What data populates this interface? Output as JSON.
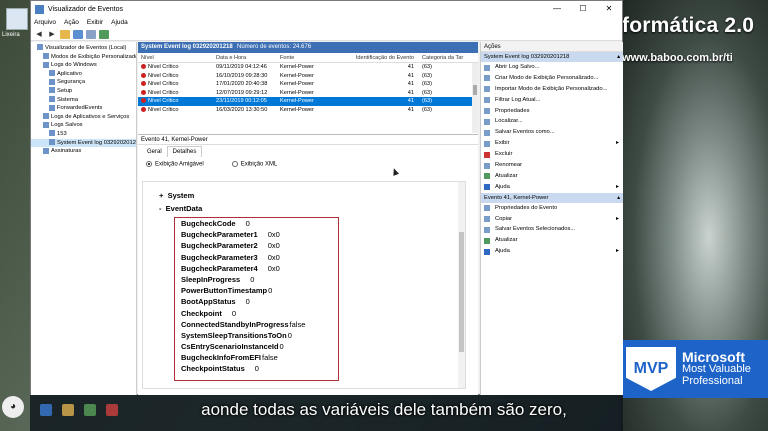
{
  "window": {
    "title": "Visualizador de Eventos",
    "controls": {
      "minimize": "—",
      "maximize": "☐",
      "close": "✕"
    }
  },
  "desktop": {
    "icon_label": "Lixeira",
    "brand": "formática 2.0",
    "brand_url": "www.baboo.com.br/ti",
    "mvp": {
      "logo": "MVP",
      "line1": "Microsoft",
      "line2": "Most Valuable",
      "line3": "Professional"
    }
  },
  "menu": [
    "Arquivo",
    "Ação",
    "Exibir",
    "Ajuda"
  ],
  "tree": [
    {
      "label": "Visualizador de Eventos (Local)",
      "indent": 1
    },
    {
      "label": "Modos de Exibição Personalizados",
      "indent": 2
    },
    {
      "label": "Logs do Windows",
      "indent": 2
    },
    {
      "label": "Aplicativo",
      "indent": 3
    },
    {
      "label": "Segurança",
      "indent": 3
    },
    {
      "label": "Setup",
      "indent": 3
    },
    {
      "label": "Sistema",
      "indent": 3
    },
    {
      "label": "ForwardedEvents",
      "indent": 3
    },
    {
      "label": "Logs de Aplicativos e Serviços",
      "indent": 2
    },
    {
      "label": "Logs Salvos",
      "indent": 2
    },
    {
      "label": "153",
      "indent": 3
    },
    {
      "label": "System Event log 032920201218",
      "indent": 3,
      "selected": true
    },
    {
      "label": "Assinaturas",
      "indent": 2
    }
  ],
  "log": {
    "name": "System Event log 032920201218",
    "count": "Número de eventos: 24.676",
    "columns": [
      "Nível",
      "Data e Hora",
      "Fonte",
      "Identificação do Evento",
      "Categoria da Tar"
    ],
    "rows": [
      {
        "level": "Nível Crítico",
        "date": "09/11/2019 04:12:46",
        "source": "Kernel-Power",
        "id": "41",
        "cat": "(63)"
      },
      {
        "level": "Nível Crítico",
        "date": "16/10/2019 09:28:30",
        "source": "Kernel-Power",
        "id": "41",
        "cat": "(63)"
      },
      {
        "level": "Nível Crítico",
        "date": "17/01/2020 20:40:38",
        "source": "Kernel-Power",
        "id": "41",
        "cat": "(63)"
      },
      {
        "level": "Nível Crítico",
        "date": "12/07/2019 09:29:12",
        "source": "Kernel-Power",
        "id": "41",
        "cat": "(63)"
      },
      {
        "level": "Nível Crítico",
        "date": "23/11/2019 00:12:05",
        "source": "Kernel-Power",
        "id": "41",
        "cat": "(63)",
        "selected": true
      },
      {
        "level": "Nível Crítico",
        "date": "16/03/2020 13:30:50",
        "source": "Kernel-Power",
        "id": "41",
        "cat": "(63)"
      }
    ]
  },
  "event": {
    "title": "Evento 41, Kernel-Power",
    "tabs": [
      "Geral",
      "Detalhes"
    ],
    "radio_friendly": "Exibição Amigável",
    "radio_xml": "Exibição XML",
    "node_system": "System",
    "node_eventdata": "EventData",
    "node_system_sign": "+",
    "node_eventdata_sign": "-",
    "properties": [
      {
        "name": "BugcheckCode",
        "value": "0"
      },
      {
        "name": "BugcheckParameter1",
        "value": "0x0"
      },
      {
        "name": "BugcheckParameter2",
        "value": "0x0"
      },
      {
        "name": "BugcheckParameter3",
        "value": "0x0"
      },
      {
        "name": "BugcheckParameter4",
        "value": "0x0"
      },
      {
        "name": "SleepInProgress",
        "value": "0"
      },
      {
        "name": "PowerButtonTimestamp",
        "value": "0"
      },
      {
        "name": "BootAppStatus",
        "value": "0"
      },
      {
        "name": "Checkpoint",
        "value": "0"
      },
      {
        "name": "ConnectedStandbyInProgress",
        "value": "false"
      },
      {
        "name": "SystemSleepTransitionsToOn",
        "value": "0"
      },
      {
        "name": "CsEntryScenarioInstanceId",
        "value": "0"
      },
      {
        "name": "BugcheckInfoFromEFI",
        "value": "false"
      },
      {
        "name": "CheckpointStatus",
        "value": "0"
      }
    ]
  },
  "actions": {
    "header": "Ações",
    "section1": "System Event log 032920201218",
    "section1_items": [
      {
        "label": "Abrir Log Salvo...",
        "icon": "folder-icon"
      },
      {
        "label": "Criar Modo de Exibição Personalizado...",
        "icon": "filter-icon"
      },
      {
        "label": "Importar Modo de Exibição Personalizado...",
        "icon": "import-icon"
      },
      {
        "label": "Filtrar Log Atual...",
        "icon": "filter-icon"
      },
      {
        "label": "Propriedades",
        "icon": "properties-icon"
      },
      {
        "label": "Localizar...",
        "icon": "find-icon"
      },
      {
        "label": "Salvar Eventos como...",
        "icon": "save-icon"
      },
      {
        "label": "Exibir",
        "icon": "view-icon",
        "submenu": true
      },
      {
        "label": "Excluir",
        "icon": "delete-icon",
        "color": "red"
      },
      {
        "label": "Renomear",
        "icon": "rename-icon"
      },
      {
        "label": "Atualizar",
        "icon": "refresh-icon",
        "color": "green"
      },
      {
        "label": "Ajuda",
        "icon": "help-icon",
        "color": "blue",
        "submenu": true
      }
    ],
    "section2": "Evento 41, Kernel-Power",
    "section2_items": [
      {
        "label": "Propriedades do Evento",
        "icon": "properties-icon"
      },
      {
        "label": "Copiar",
        "icon": "copy-icon",
        "submenu": true
      },
      {
        "label": "Salvar Eventos Selecionados...",
        "icon": "save-icon"
      },
      {
        "label": "Atualizar",
        "icon": "refresh-icon",
        "color": "green"
      },
      {
        "label": "Ajuda",
        "icon": "help-icon",
        "color": "blue",
        "submenu": true
      }
    ],
    "submenu_arrow": "▸",
    "collapse_arrow": "▴"
  },
  "subtitle": "aonde todas as variáveis dele também são zero,"
}
